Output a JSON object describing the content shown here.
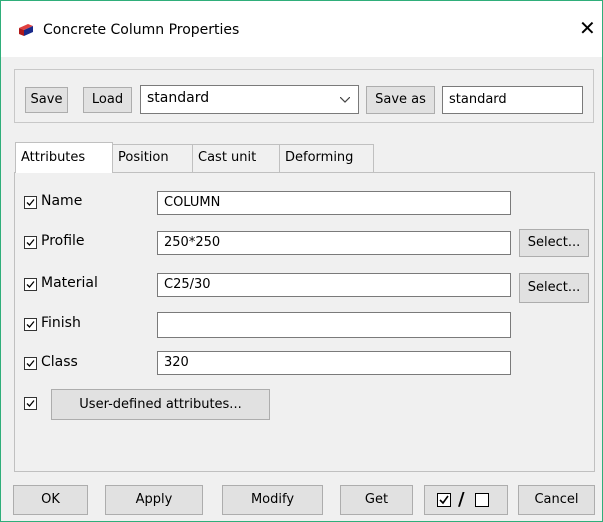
{
  "window": {
    "title": "Concrete Column Properties",
    "close_label": "✕"
  },
  "toolbar": {
    "save_label": "Save",
    "load_label": "Load",
    "preset_value": "standard",
    "save_as_label": "Save as",
    "save_as_value": "standard"
  },
  "tabs": [
    {
      "label": "Attributes",
      "active": true
    },
    {
      "label": "Position"
    },
    {
      "label": "Cast unit"
    },
    {
      "label": "Deforming"
    }
  ],
  "attributes": {
    "rows": [
      {
        "label": "Name",
        "value": "COLUMN",
        "checked": true
      },
      {
        "label": "Profile",
        "value": "250*250",
        "checked": true,
        "select_label": "Select..."
      },
      {
        "label": "Material",
        "value": "C25/30",
        "checked": true,
        "select_label": "Select..."
      },
      {
        "label": "Finish",
        "value": "",
        "checked": true
      },
      {
        "label": "Class",
        "value": "320",
        "checked": true
      }
    ],
    "user_defined_label": "User-defined attributes...",
    "user_defined_checked": true
  },
  "buttons": {
    "ok": "OK",
    "apply": "Apply",
    "modify": "Modify",
    "get": "Get",
    "cancel": "Cancel"
  },
  "toggle_all": {
    "separator": "/"
  },
  "colors": {
    "window_border": "#2fae7a",
    "dialog_bg": "#f0f0f0",
    "icon_red": "#d42020"
  }
}
